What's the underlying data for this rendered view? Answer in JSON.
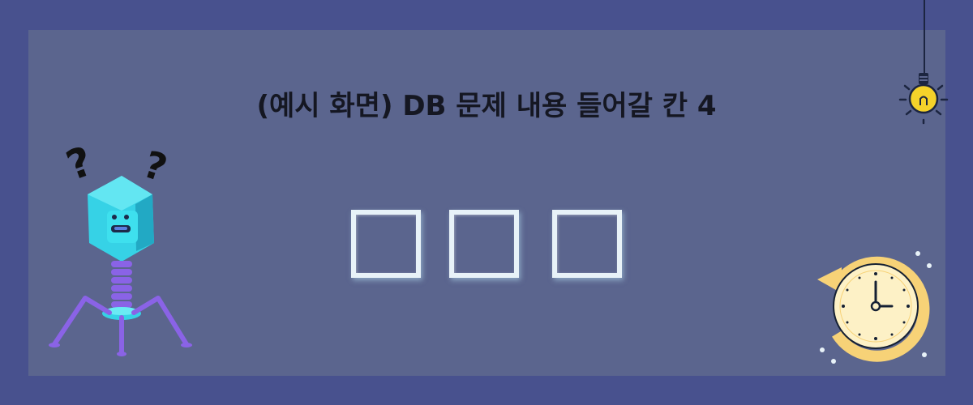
{
  "title": "(예시 화면) DB 문제 내용 들어갈 칸 4",
  "answer_boxes": [
    {
      "value": ""
    },
    {
      "value": ""
    },
    {
      "value": ""
    }
  ],
  "colors": {
    "background": "#48518e",
    "panel": "#5b658e",
    "title_text": "#151722",
    "box_border": "#e8f2f8",
    "virus_head": "#3ad6ea",
    "virus_body": "#8a63e6",
    "bulb_glow": "#f5d22a",
    "clock_face": "#fdf1c6"
  },
  "icons": {
    "question_marks": "question-marks-icon",
    "virus": "virus-character-icon",
    "bulb": "lightbulb-icon",
    "clock": "clock-history-icon"
  }
}
